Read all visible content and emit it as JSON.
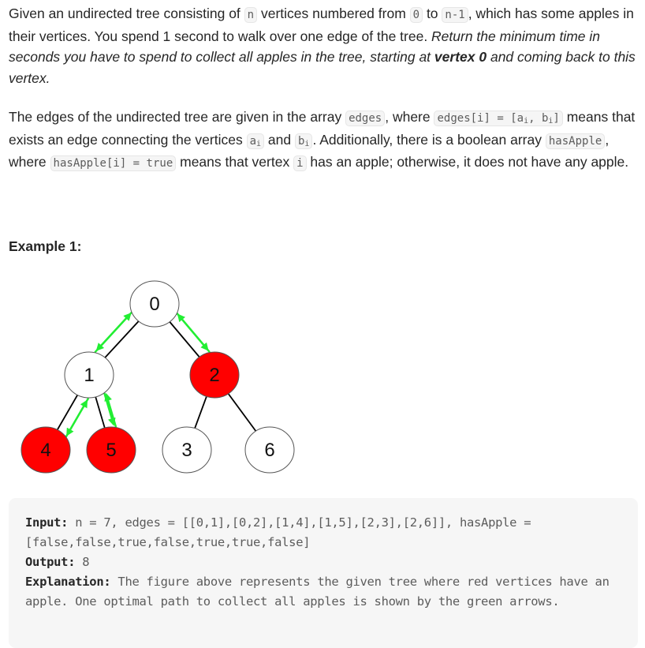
{
  "description": {
    "p1": {
      "t1": "Given an undirected tree consisting of ",
      "c_n": "n",
      "t2": " vertices numbered from ",
      "c_zero": "0",
      "t3": " to ",
      "c_nminus1": "n-1",
      "t4": ", which has some apples in their vertices. You spend 1 second to walk over one edge of the tree. ",
      "em1": "Return the minimum time in seconds you have to spend to collect all apples in the tree, starting at ",
      "strong": "vertex 0",
      "em2": " and coming back to this vertex."
    },
    "p2": {
      "t1": "The edges of the undirected tree are given in the array ",
      "c_edges": "edges",
      "t2": ", where ",
      "c_edges_def": "edges[i] = [a",
      "c_sub_i1": "i",
      "c_mid": ", b",
      "c_sub_i2": "i",
      "c_end": "]",
      "t3": " means that exists an edge connecting the vertices ",
      "c_a": "a",
      "c_a_sub": "i",
      "t4": " and ",
      "c_b": "b",
      "c_b_sub": "i",
      "t5": ". Additionally, there is a boolean array ",
      "c_hasApple": "hasApple",
      "t6": ", where ",
      "c_hasApple_def": "hasApple[i] = true",
      "t7": " means that vertex ",
      "c_i": "i",
      "t8": " has an apple; otherwise, it does not have any apple."
    }
  },
  "example": {
    "title": "Example 1:",
    "figure": {
      "nodes": [
        {
          "id": "0",
          "apple": false
        },
        {
          "id": "1",
          "apple": false
        },
        {
          "id": "2",
          "apple": true
        },
        {
          "id": "3",
          "apple": false
        },
        {
          "id": "4",
          "apple": true
        },
        {
          "id": "5",
          "apple": true
        },
        {
          "id": "6",
          "apple": false
        }
      ],
      "edges": [
        [
          "0",
          "1"
        ],
        [
          "0",
          "2"
        ],
        [
          "1",
          "4"
        ],
        [
          "1",
          "5"
        ],
        [
          "2",
          "3"
        ],
        [
          "2",
          "6"
        ]
      ],
      "path_arrows": [
        [
          "0",
          "1"
        ],
        [
          "1",
          "4"
        ],
        [
          "4",
          "1"
        ],
        [
          "1",
          "5"
        ],
        [
          "5",
          "1"
        ],
        [
          "1",
          "0"
        ],
        [
          "0",
          "2"
        ],
        [
          "2",
          "0"
        ]
      ],
      "colors": {
        "apple": "#ff0000",
        "plain": "#ffffff",
        "arrow": "#22ee33",
        "edge": "#000000"
      }
    },
    "input_label": "Input:",
    "input_value": " n = 7, edges = [[0,1],[0,2],[1,4],[1,5],[2,3],[2,6]], hasApple = [false,false,true,false,true,true,false]",
    "output_label": "Output:",
    "output_value": " 8",
    "explanation_label": "Explanation:",
    "explanation_value": " The figure above represents the given tree where red vertices have an apple. One optimal path to collect all apples is shown by the green arrows."
  }
}
